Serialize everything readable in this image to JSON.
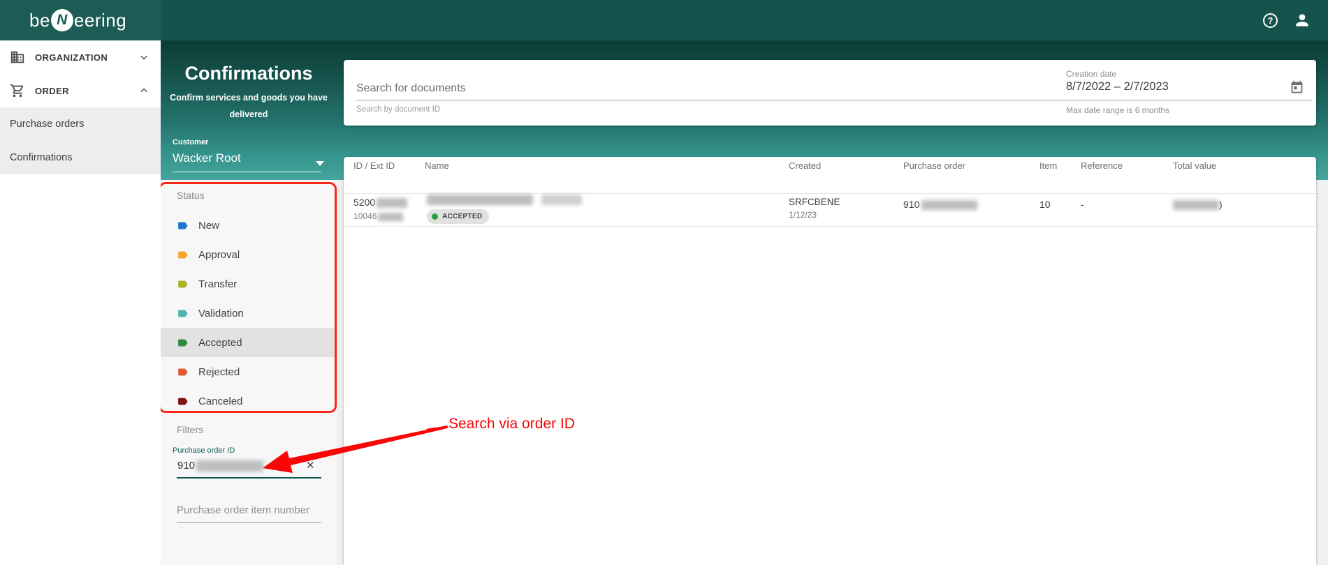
{
  "topbar": {
    "logo_pre": "be",
    "logo_n": "N",
    "logo_post": "eering",
    "help_glyph": "?"
  },
  "sidebar": {
    "organization": "ORGANIZATION",
    "order": "ORDER",
    "purchase_orders": "Purchase orders",
    "confirmations": "Confirmations"
  },
  "panel": {
    "title": "Confirmations",
    "subtitle": "Confirm services and goods you have delivered",
    "customer_label": "Customer",
    "customer_value": "Wacker Root",
    "status_label": "Status",
    "statuses": [
      {
        "label": "New",
        "color": "#1d76d2"
      },
      {
        "label": "Approval",
        "color": "#f6a42c"
      },
      {
        "label": "Transfer",
        "color": "#a9b326"
      },
      {
        "label": "Validation",
        "color": "#4cb4aa"
      },
      {
        "label": "Accepted",
        "color": "#2f8a3e"
      },
      {
        "label": "Rejected",
        "color": "#e05b36"
      },
      {
        "label": "Canceled",
        "color": "#7e1210"
      }
    ],
    "active_status": "Accepted",
    "filters_label": "Filters",
    "po_id_label": "Purchase order ID",
    "po_id_value": "910",
    "clear_glyph": "✕",
    "po_item_placeholder": "Purchase order item number"
  },
  "search": {
    "placeholder": "Search for documents",
    "hint": "Search by document ID",
    "creation_date_label": "Creation date",
    "creation_date_value": "8/7/2022 – 2/7/2023",
    "creation_date_hint": "Max date range is 6 months"
  },
  "table": {
    "headers": [
      "ID / Ext ID",
      "Name",
      "Created",
      "Purchase order",
      "Item",
      "Reference",
      "Total value"
    ],
    "row": {
      "id": "5200",
      "ext_id": "10046",
      "status_badge": "ACCEPTED",
      "created_doc": "SRFCBENE",
      "created_date": "1/12/23",
      "purchase_order": "910",
      "item": "10",
      "reference": "-",
      "total_value_suffix": ")"
    }
  },
  "annotation": {
    "text": "Search via order ID",
    "color": "#f90606",
    "box_color": "#f5281a"
  },
  "colors": {
    "accent_teal": "#0d574f",
    "topbar": "#14544d"
  }
}
